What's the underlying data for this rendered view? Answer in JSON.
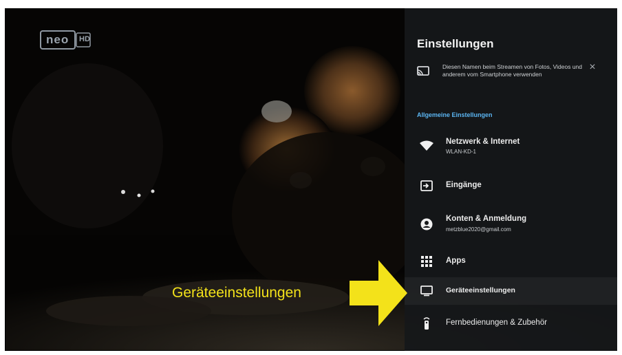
{
  "channel_logo": {
    "text": "neo",
    "hd": "HD"
  },
  "settings": {
    "title": "Einstellungen",
    "cast_notice": {
      "icon": "cast-icon",
      "text": "Diesen Namen beim Streamen von Fotos, Videos und anderem vom Smartphone verwenden",
      "close_label": "×"
    },
    "section_header": "Allgemeine Einstellungen",
    "items": [
      {
        "icon": "wifi-icon",
        "label": "Netzwerk & Internet",
        "sublabel": "WLAN-KD-1"
      },
      {
        "icon": "input-icon",
        "label": "Eingänge"
      },
      {
        "icon": "account-icon",
        "label": "Konten & Anmeldung",
        "sublabel": "metzblue2020@gmail.com"
      },
      {
        "icon": "apps-grid-icon",
        "label": "Apps"
      },
      {
        "icon": "tv-icon",
        "label": "Geräteeinstellungen"
      },
      {
        "icon": "remote-icon",
        "label": "Fernbedienungen & Zubehör"
      }
    ],
    "colors": {
      "panel_bg": "#16181a",
      "section_header": "#5bb5f2",
      "annotation": "#f3e21a"
    }
  },
  "annotation": {
    "label": "Geräteeinstellungen",
    "arrow_icon": "arrow-right-icon"
  }
}
